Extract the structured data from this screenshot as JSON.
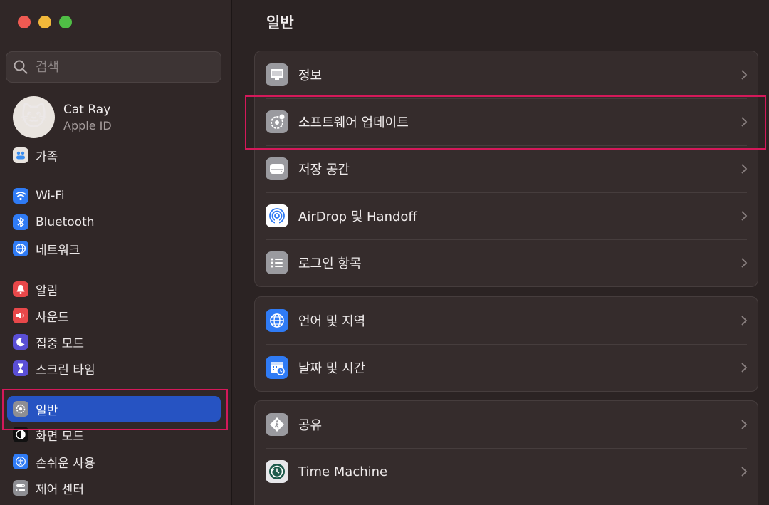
{
  "window": {
    "title": "일반"
  },
  "search": {
    "placeholder": "검색"
  },
  "profile": {
    "name": "Cat Ray",
    "subtitle": "Apple ID",
    "avatar_glyph": "🐱"
  },
  "sidebar": {
    "items": [
      {
        "label": "가족",
        "icon": "family-icon",
        "color": "#e9e4df"
      },
      {
        "label": "Wi-Fi",
        "icon": "wifi-icon",
        "color": "#2f7bf5"
      },
      {
        "label": "Bluetooth",
        "icon": "bluetooth-icon",
        "color": "#2f7bf5"
      },
      {
        "label": "네트워크",
        "icon": "globe-icon",
        "color": "#2f7bf5"
      },
      {
        "label": "알림",
        "icon": "bell-icon",
        "color": "#e8484a"
      },
      {
        "label": "사운드",
        "icon": "speaker-icon",
        "color": "#e8484a"
      },
      {
        "label": "집중 모드",
        "icon": "moon-icon",
        "color": "#5a4fd6"
      },
      {
        "label": "스크린 타임",
        "icon": "hourglass-icon",
        "color": "#5a4fd6"
      },
      {
        "label": "일반",
        "icon": "gear-icon",
        "color": "#8e8e93",
        "active": true
      },
      {
        "label": "화면 모드",
        "icon": "appearance-icon",
        "color": "#111111"
      },
      {
        "label": "손쉬운 사용",
        "icon": "accessibility-icon",
        "color": "#2f7bf5"
      },
      {
        "label": "제어 센터",
        "icon": "control-center-icon",
        "color": "#8e8e93"
      }
    ]
  },
  "main": {
    "title": "일반",
    "groups": [
      {
        "rows": [
          {
            "label": "정보",
            "icon": "computer-icon"
          },
          {
            "label": "소프트웨어 업데이트",
            "icon": "gear-badge-icon"
          },
          {
            "label": "저장 공간",
            "icon": "drive-icon"
          },
          {
            "label": "AirDrop 및 Handoff",
            "icon": "airdrop-icon"
          },
          {
            "label": "로그인 항목",
            "icon": "list-icon"
          }
        ]
      },
      {
        "rows": [
          {
            "label": "언어 및 지역",
            "icon": "globe-icon"
          },
          {
            "label": "날짜 및 시간",
            "icon": "calendar-clock-icon"
          }
        ]
      },
      {
        "rows": [
          {
            "label": "공유",
            "icon": "sharing-icon"
          },
          {
            "label": "Time Machine",
            "icon": "time-machine-icon"
          }
        ]
      }
    ]
  },
  "colors": {
    "accent": "#2653c2",
    "highlight": "#d4195a"
  }
}
